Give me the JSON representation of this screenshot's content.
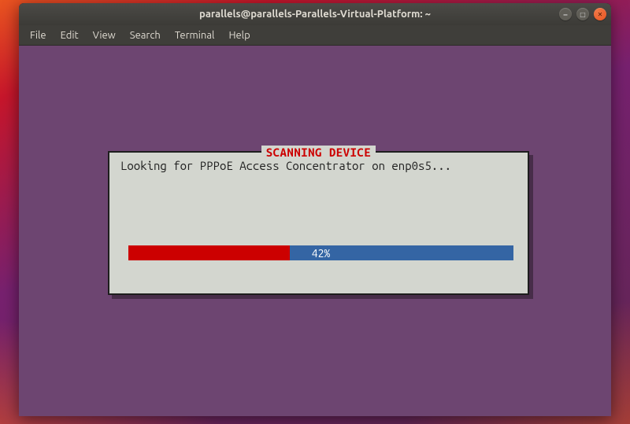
{
  "window": {
    "title": "parallels@parallels-Parallels-Virtual-Platform: ~"
  },
  "menubar": {
    "items": [
      "File",
      "Edit",
      "View",
      "Search",
      "Terminal",
      "Help"
    ]
  },
  "dialog": {
    "title": "SCANNING DEVICE",
    "message": "Looking for PPPoE Access Concentrator on enp0s5...",
    "progress_percent": 42,
    "progress_label": "42%"
  },
  "colors": {
    "terminal_bg": "#6d4571",
    "dialog_bg": "#d3d6cf",
    "progress_bg": "#3465a4",
    "progress_fill": "#cc0000",
    "title_color": "#cc0000"
  }
}
